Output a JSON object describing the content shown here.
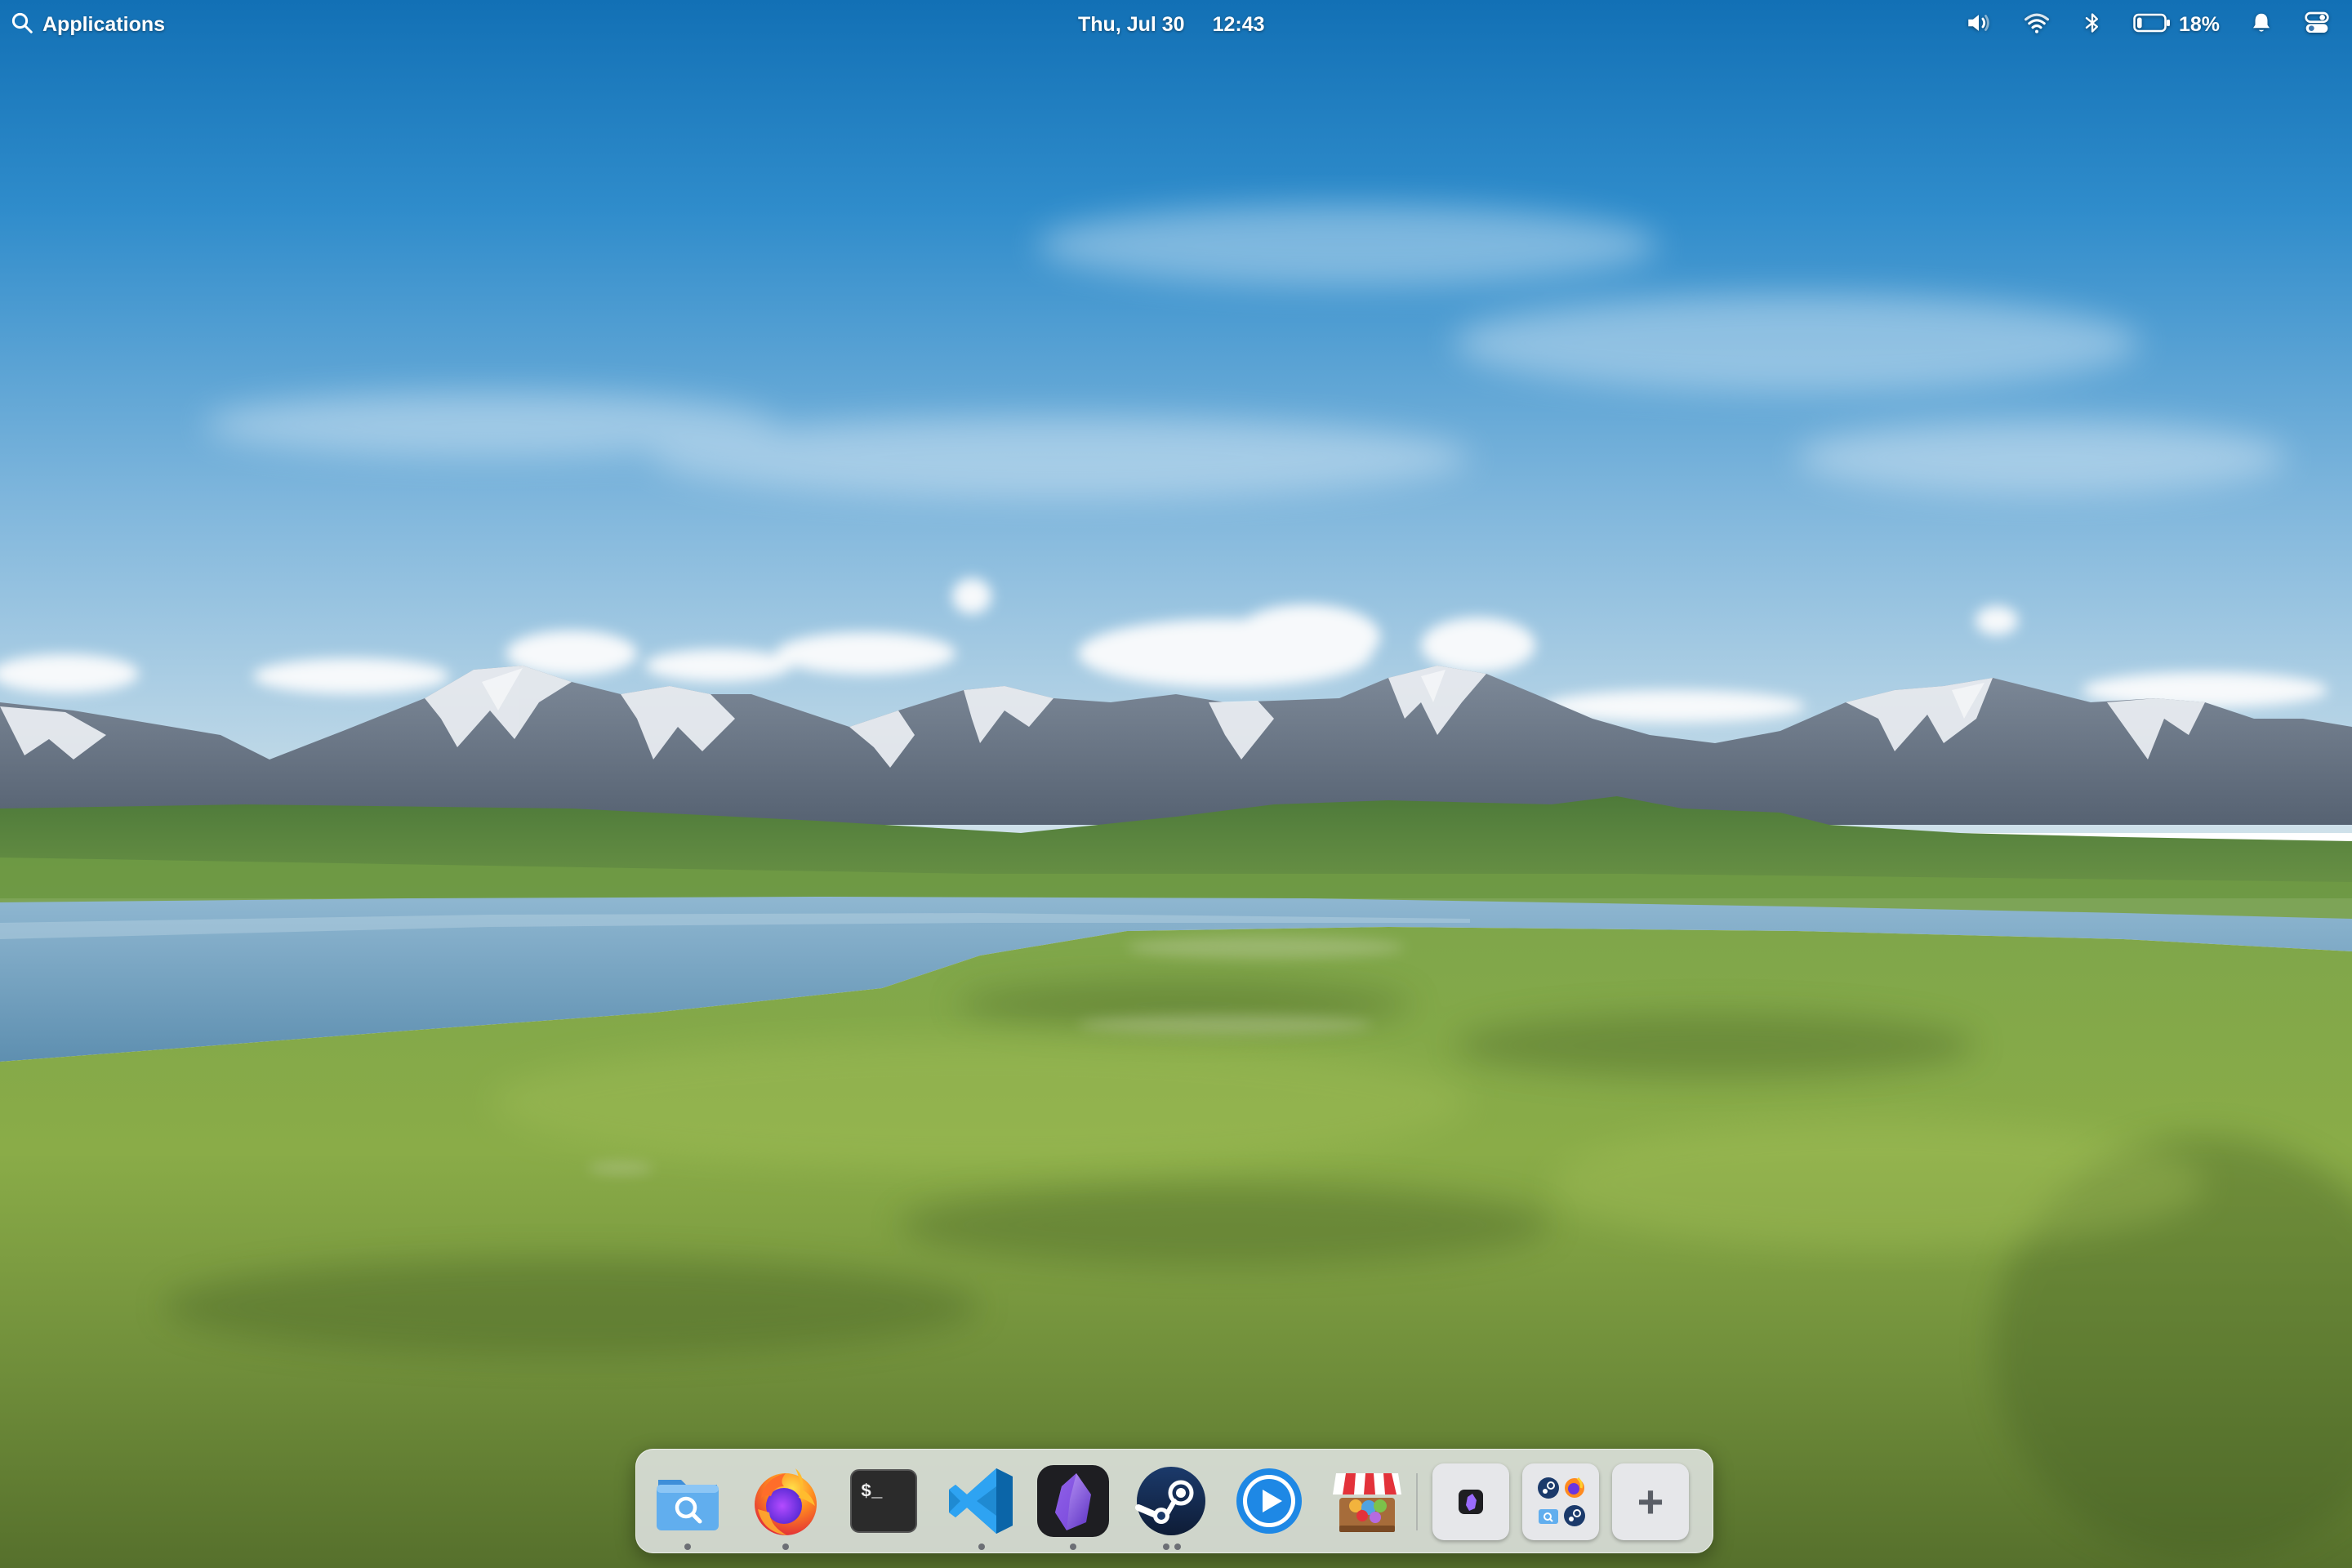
{
  "panel": {
    "applications_label": "Applications",
    "date": "Thu, Jul 30",
    "time": "12:43",
    "battery_percent": "18%",
    "battery_level": 0.18
  },
  "icons": {
    "search": "search-icon",
    "volume": "volume-icon",
    "wifi": "wifi-icon",
    "bluetooth": "bluetooth-icon",
    "battery": "battery-icon",
    "notifications": "bell-icon",
    "system_menu": "toggle-switches-icon"
  },
  "dock": {
    "apps": [
      {
        "name": "Files",
        "icon": "folder-search-icon",
        "running": true
      },
      {
        "name": "Firefox",
        "icon": "firefox-icon",
        "running": true
      },
      {
        "name": "Terminal",
        "icon": "terminal-icon",
        "running": false,
        "glyph": "$_"
      },
      {
        "name": "Visual Studio Code",
        "icon": "vscode-icon",
        "running": true
      },
      {
        "name": "Obsidian",
        "icon": "obsidian-icon",
        "running": true
      },
      {
        "name": "Steam",
        "icon": "steam-icon",
        "running": true,
        "windows": 2
      },
      {
        "name": "Media Player",
        "icon": "play-icon",
        "running": false
      },
      {
        "name": "AppCenter",
        "icon": "store-icon",
        "running": false
      }
    ],
    "workspaces_label": "Workspaces",
    "add_workspace_label": "+"
  },
  "colors": {
    "panel_text": "#ffffff",
    "dock_background": "#eceef2",
    "sky_top": "#1778bd",
    "sky_horizon": "#c6dbe6"
  }
}
